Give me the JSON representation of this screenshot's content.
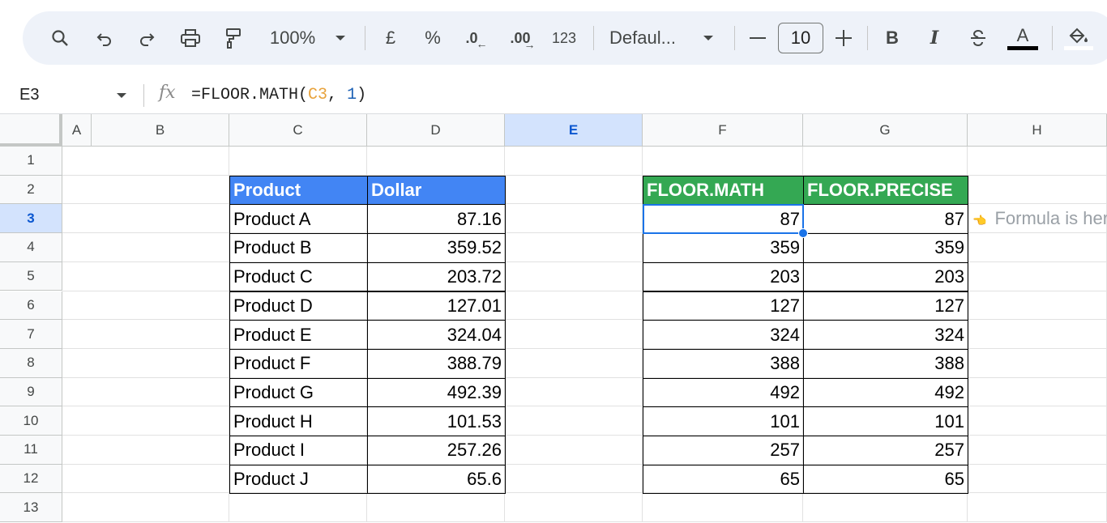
{
  "toolbar": {
    "zoom": "100%",
    "currency": "£",
    "percent": "%",
    "dec_decrease": ".0",
    "dec_increase": ".00",
    "number_format": "123",
    "font": "Defaul...",
    "font_size": "10",
    "bold": "B",
    "italic": "I",
    "text_color": "A"
  },
  "formula_bar": {
    "name_box": "E3",
    "fx": "fx",
    "formula_prefix": "=FLOOR.MATH(",
    "formula_ref": "C3",
    "formula_sep": ", ",
    "formula_num": "1",
    "formula_suffix": ")"
  },
  "columns": [
    "A",
    "B",
    "C",
    "D",
    "E",
    "F",
    "G",
    "H"
  ],
  "rows": [
    "1",
    "2",
    "3",
    "4",
    "5",
    "6",
    "7",
    "8",
    "9",
    "10",
    "11",
    "12",
    "13"
  ],
  "table1": {
    "headers": [
      "Product",
      "Dollar"
    ],
    "rows": [
      [
        "Product A",
        "87.16"
      ],
      [
        "Product B",
        "359.52"
      ],
      [
        "Product C",
        "203.72"
      ],
      [
        "Product D",
        "127.01"
      ],
      [
        "Product E",
        "324.04"
      ],
      [
        "Product F",
        "388.79"
      ],
      [
        "Product G",
        "492.39"
      ],
      [
        "Product H",
        "101.53"
      ],
      [
        "Product I",
        "257.26"
      ],
      [
        "Product J",
        "65.6"
      ]
    ]
  },
  "table2": {
    "headers": [
      "FLOOR.MATH",
      "FLOOR.PRECISE"
    ],
    "rows": [
      [
        "87",
        "87"
      ],
      [
        "359",
        "359"
      ],
      [
        "203",
        "203"
      ],
      [
        "127",
        "127"
      ],
      [
        "324",
        "324"
      ],
      [
        "388",
        "388"
      ],
      [
        "492",
        "492"
      ],
      [
        "101",
        "101"
      ],
      [
        "257",
        "257"
      ],
      [
        "65",
        "65"
      ]
    ]
  },
  "annotation": "Formula is here",
  "selected_cell": "E3",
  "colors": {
    "header_blue": "#4285f4",
    "header_green": "#34a853",
    "selection": "#1a73e8"
  }
}
